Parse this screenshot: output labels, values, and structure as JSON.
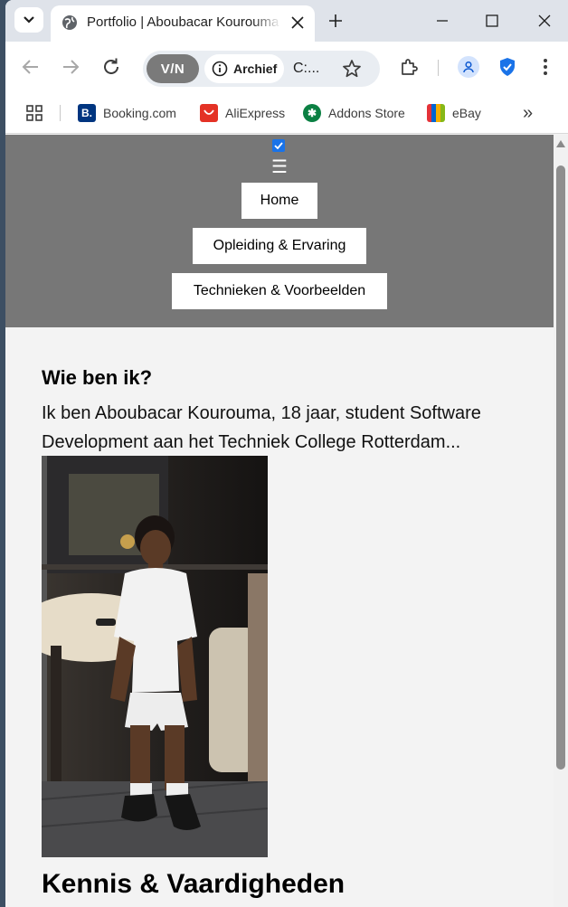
{
  "browser": {
    "tab": {
      "title": "Portfolio | Aboubacar Kourouma"
    },
    "omnibox": {
      "vpn_label": "V/N",
      "chip_label": "Archief",
      "url": "C:..."
    },
    "bookmarks": [
      {
        "label": "Booking.com",
        "icon": "booking-icon",
        "color": "#003580"
      },
      {
        "label": "AliExpress",
        "icon": "aliexpress-icon",
        "color": "#e43225"
      },
      {
        "label": "Addons Store",
        "icon": "addons-store-icon",
        "color": "#0b8043"
      },
      {
        "label": "eBay",
        "icon": "ebay-icon",
        "color": "#e53238"
      }
    ],
    "overflow": "»"
  },
  "page": {
    "nav": {
      "hamburger": "☰",
      "links": [
        "Home",
        "Opleiding & Ervaring",
        "Technieken & Voorbeelden"
      ]
    },
    "about": {
      "heading": "Wie ben ik?",
      "text": "Ik ben Aboubacar Kourouma, 18 jaar, student Software Development aan het Techniek College Rotterdam..."
    },
    "skills_heading": "Kennis & Vaardigheden"
  }
}
